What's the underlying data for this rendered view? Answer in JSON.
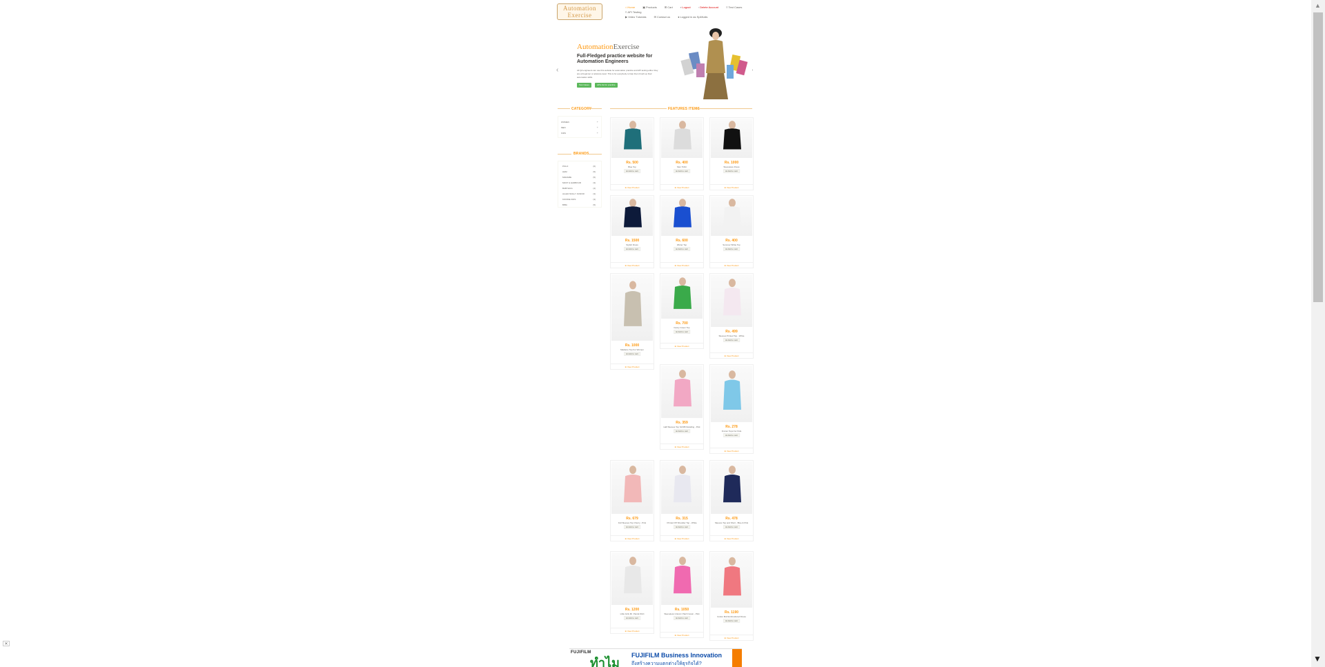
{
  "header": {
    "logo_line1": "Automation",
    "logo_line2": "Exercise",
    "nav": [
      {
        "label": "Home",
        "icon": "home-icon"
      },
      {
        "label": "Products",
        "icon": "products-icon"
      },
      {
        "label": "Cart",
        "icon": "cart-icon"
      },
      {
        "label": "Logout",
        "icon": "lock-icon"
      },
      {
        "label": "Delete Account",
        "icon": "trash-icon"
      },
      {
        "label": "Test Cases",
        "icon": "list-icon"
      },
      {
        "label": "API Testing",
        "icon": "list-icon"
      },
      {
        "label": "Video Tutorials",
        "icon": "youtube-icon"
      },
      {
        "label": "Contact us",
        "icon": "envelope-icon"
      },
      {
        "label": "Logged in as Sp6Kalis",
        "icon": "user-icon"
      }
    ]
  },
  "slider": {
    "brand_a": "Automation",
    "brand_b": "Exercise",
    "heading": "Full-Fledged practice website for Automation Engineers",
    "text": "All QA engineers can use this website for automation practice and API testing either they are at beginner or advance level. This is for everybody to help them brush up their automation skills.",
    "btn_test_cases": "Test Cases",
    "btn_apis": "APIs list for practice"
  },
  "sidebar": {
    "category_title": "CATEGORY",
    "categories": [
      "WOMEN",
      "MEN",
      "KIDS"
    ],
    "brands_title": "BRANDS",
    "brands": [
      {
        "name": "POLO",
        "count": "(6)"
      },
      {
        "name": "H&M",
        "count": "(5)"
      },
      {
        "name": "MADAME",
        "count": "(5)"
      },
      {
        "name": "MAST & HARBOUR",
        "count": "(3)"
      },
      {
        "name": "BABYHUG",
        "count": "(4)"
      },
      {
        "name": "ALLEN SOLLY JUNIOR",
        "count": "(3)"
      },
      {
        "name": "KOOKIE KIDS",
        "count": "(3)"
      },
      {
        "name": "BIBA",
        "count": "(5)"
      }
    ]
  },
  "products": {
    "title": "FEATURES ITEMS",
    "add_label": "Add to cart",
    "view_label": "View Product",
    "items": [
      {
        "price": "Rs. 500",
        "name": "Blue Top"
      },
      {
        "price": "Rs. 400",
        "name": "Men Tshirt"
      },
      {
        "price": "Rs. 1000",
        "name": "Sleeveless Dress"
      },
      {
        "price": "Rs. 1500",
        "name": "Stylish Dress"
      },
      {
        "price": "Rs. 600",
        "name": "Winter Top"
      },
      {
        "price": "Rs. 400",
        "name": "Summer White Top"
      },
      {
        "price": "Rs. 1000",
        "name": "Madame Top For Women"
      },
      {
        "price": "Rs. 700",
        "name": "Fancy Green Top"
      },
      {
        "price": "Rs. 499",
        "name": "Sleeves Printed Top - White"
      },
      {
        "price": "Rs. 359",
        "name": "Half Sleeves Top Schiffli Detailing - Pink"
      },
      {
        "price": "Rs. 278",
        "name": "Frozen Tops For Kids"
      },
      {
        "price": "Rs. 679",
        "name": "Full Sleeves Top Cherry - Pink"
      },
      {
        "price": "Rs. 315",
        "name": "Printed Off Shoulder Top - White"
      },
      {
        "price": "Rs. 478",
        "name": "Sleeves Top and Short - Blue & Pink"
      },
      {
        "price": "Rs. 1200",
        "name": "Little Girls Mr. Panda Shirt"
      },
      {
        "price": "Rs. 1050",
        "name": "Sleeveless Unicorn Patch Gown - Pink"
      },
      {
        "price": "Rs. 1190",
        "name": "Cotton Mull Embroidered Dress"
      }
    ]
  },
  "ad": {
    "brand": "FUJIFILM",
    "thai_big": "ทำไม",
    "line1": "FUJIFILM Business Innovation",
    "line2": "ถึงสร้างความแตกต่างให้ธุรกิจได้?",
    "close": "✕"
  }
}
